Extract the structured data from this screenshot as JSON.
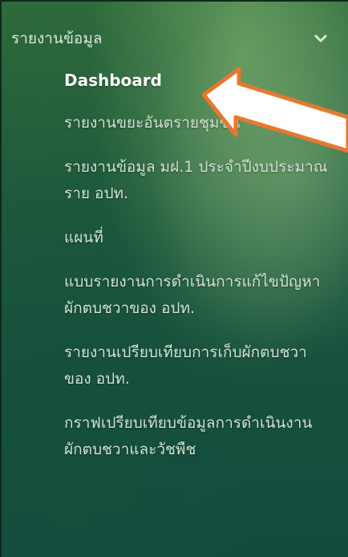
{
  "menu": {
    "title": "รายงานข้อมูล",
    "chevron_icon": "chevron-down-icon",
    "items": [
      {
        "label": "Dashboard",
        "active": true
      },
      {
        "label": "รายงานขยะอันตรายชุมชน"
      },
      {
        "label": "รายงานข้อมูล มฝ.1 ประจำปีงบประมาณ ราย อปท."
      },
      {
        "label": "แผนที่"
      },
      {
        "label": "แบบรายงานการดำเนินการแก้ไขปัญหาผักตบชวาของ อปท."
      },
      {
        "label": "รายงานเปรียบเทียบการเก็บผักตบชวาของ อปท."
      },
      {
        "label": "กราฟเปรียบเทียบข้อมูลการดำเนินงานผักตบชวาและวัชพืช"
      }
    ]
  },
  "annotation": {
    "icon": "arrow-left-icon",
    "color": "#e8772e"
  }
}
